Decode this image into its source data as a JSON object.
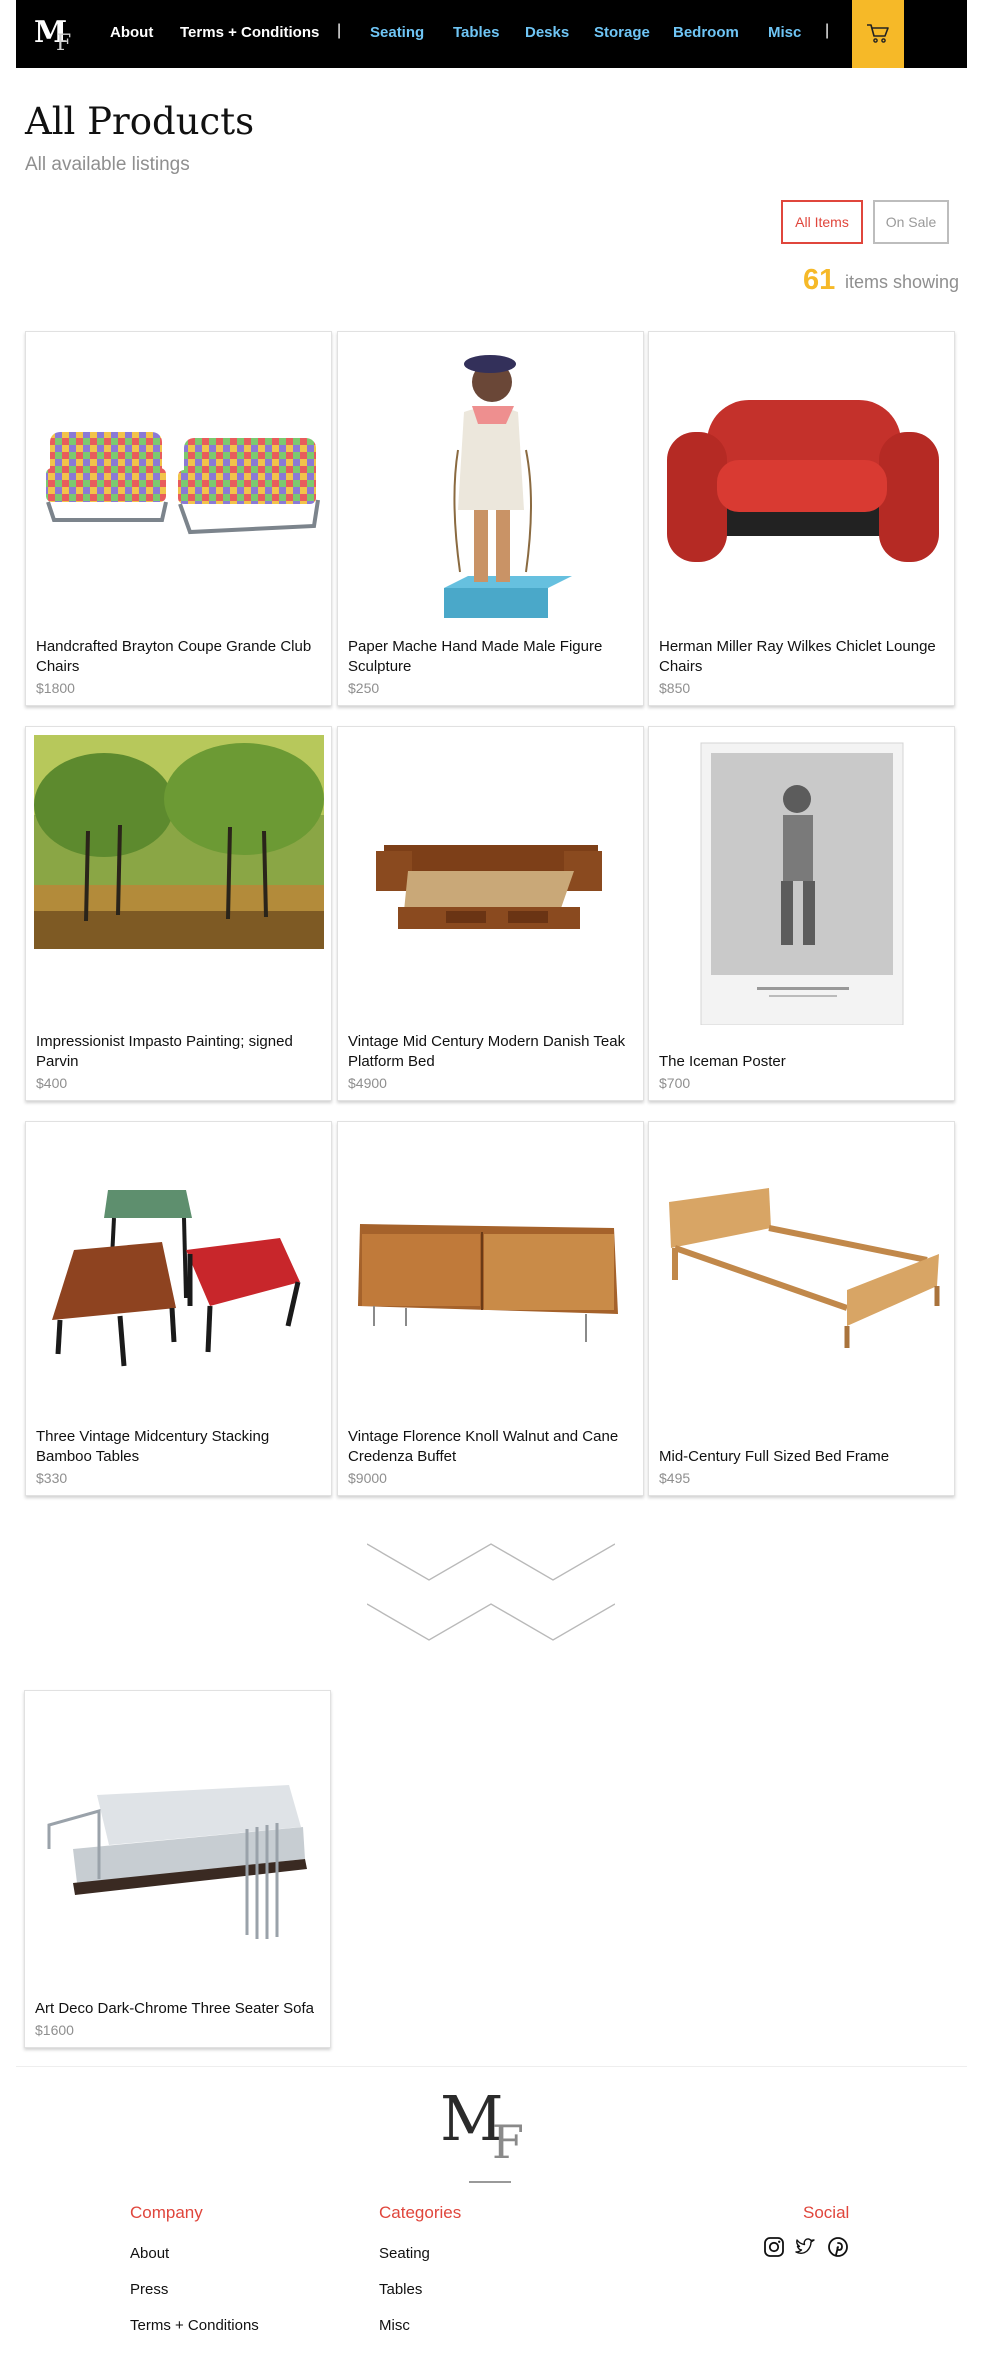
{
  "nav": {
    "links_primary": [
      "About",
      "Terms + Conditions"
    ],
    "separator": "|",
    "categories": [
      "Seating",
      "Tables",
      "Desks",
      "Storage",
      "Bedroom",
      "Misc"
    ],
    "accent_color": "#f6b928",
    "category_color": "#6fc5f5"
  },
  "header": {
    "title": "All Products",
    "subtitle": "All available listings"
  },
  "filters": {
    "all_items": "All Items",
    "on_sale": "On Sale",
    "selected": "All Items",
    "selected_color": "#e0463c"
  },
  "count": {
    "number": "61",
    "label": "items showing"
  },
  "products": [
    {
      "name": "Handcrafted Brayton Coupe Grande Club Chairs",
      "price": "$1800",
      "image": "patchwork-club-chairs"
    },
    {
      "name": "Paper Mache Hand Made Male Figure Sculpture",
      "price": "$250",
      "image": "paper-mache-figure"
    },
    {
      "name": "Herman Miller Ray Wilkes Chiclet Lounge Chairs",
      "price": "$850",
      "image": "red-lounge-chair"
    },
    {
      "name": "Impressionist Impasto Painting; signed Parvin",
      "price": "$400",
      "image": "impasto-painting"
    },
    {
      "name": "Vintage Mid Century Modern Danish Teak Platform Bed",
      "price": "$4900",
      "image": "teak-platform-bed"
    },
    {
      "name": "The Iceman Poster",
      "price": "$700",
      "image": "iceman-poster"
    },
    {
      "name": "Three Vintage Midcentury Stacking Bamboo Tables",
      "price": "$330",
      "image": "stacking-tables"
    },
    {
      "name": "Vintage Florence Knoll Walnut and Cane Credenza Buffet",
      "price": "$9000",
      "image": "walnut-credenza"
    },
    {
      "name": "Mid-Century Full Sized Bed Frame",
      "price": "$495",
      "image": "bed-frame"
    },
    {
      "name": "Art Deco Dark-Chrome Three Seater Sofa",
      "price": "$1600",
      "image": "chrome-sofa"
    }
  ],
  "footer": {
    "company": {
      "heading": "Company",
      "links": [
        "About",
        "Press",
        "Terms + Conditions"
      ]
    },
    "categories": {
      "heading": "Categories",
      "links": [
        "Seating",
        "Tables",
        "Misc"
      ]
    },
    "social": {
      "heading": "Social",
      "icons": [
        "instagram-icon",
        "twitter-icon",
        "pinterest-icon"
      ]
    },
    "heading_color": "#e0463c"
  }
}
